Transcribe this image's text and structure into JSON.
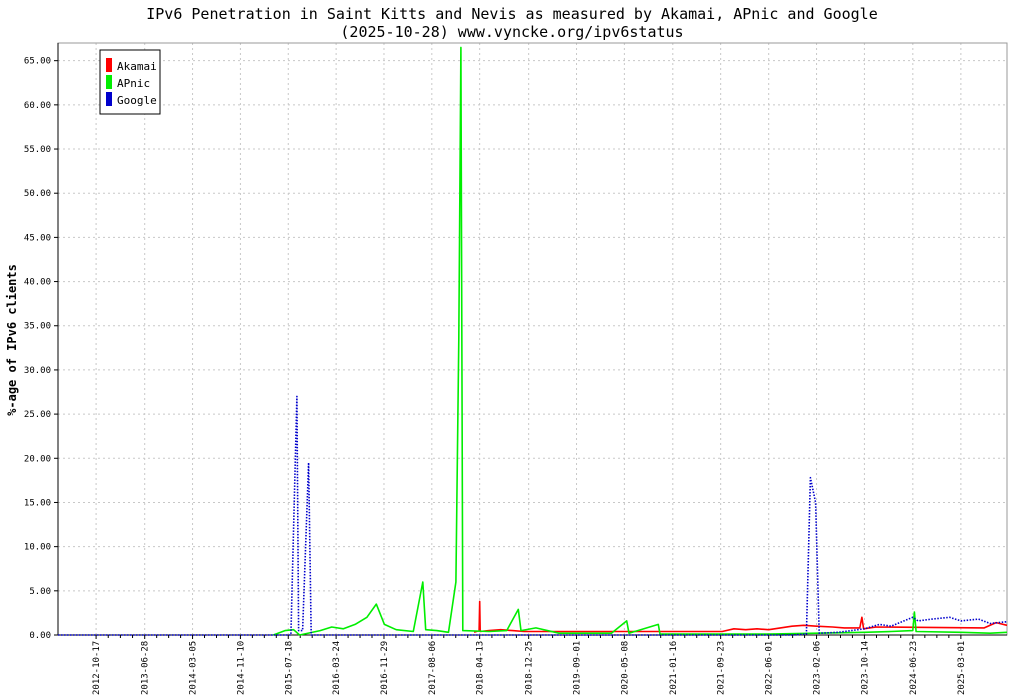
{
  "chart_data": {
    "type": "line",
    "title": "IPv6 Penetration in Saint Kitts and Nevis as measured by Akamai, APnic and Google",
    "subtitle": "(2025-10-28) www.vyncke.org/ipv6status",
    "xlabel": "",
    "ylabel": "%-age of IPv6 clients",
    "x_range": [
      "2012-04-01",
      "2025-10-28"
    ],
    "ylim": [
      0,
      67
    ],
    "y_ticks": [
      "0.00",
      "5.00",
      "10.00",
      "15.00",
      "20.00",
      "25.00",
      "30.00",
      "35.00",
      "40.00",
      "45.00",
      "50.00",
      "55.00",
      "60.00",
      "65.00"
    ],
    "x_ticks": [
      "2012-10-17",
      "2013-06-28",
      "2014-03-05",
      "2014-11-10",
      "2015-07-18",
      "2016-03-24",
      "2016-11-29",
      "2017-08-06",
      "2018-04-13",
      "2018-12-25",
      "2019-09-01",
      "2020-05-08",
      "2021-01-16",
      "2021-09-23",
      "2022-06-01",
      "2023-02-06",
      "2023-10-14",
      "2024-06-23",
      "2025-03-01"
    ],
    "grid": true,
    "legend": "top-left",
    "series": [
      {
        "name": "Akamai",
        "color": "#ff0000",
        "style": "solid",
        "points": [
          [
            "2018-03-15",
            0.3
          ],
          [
            "2018-04-10",
            0.5
          ],
          [
            "2018-04-13",
            3.8
          ],
          [
            "2018-04-16",
            0.4
          ],
          [
            "2018-06-01",
            0.5
          ],
          [
            "2018-08-01",
            0.6
          ],
          [
            "2018-10-01",
            0.5
          ],
          [
            "2018-12-01",
            0.4
          ],
          [
            "2021-10-01",
            0.4
          ],
          [
            "2021-12-01",
            0.7
          ],
          [
            "2022-02-01",
            0.6
          ],
          [
            "2022-04-01",
            0.7
          ],
          [
            "2022-06-01",
            0.6
          ],
          [
            "2022-08-01",
            0.8
          ],
          [
            "2022-10-01",
            1.0
          ],
          [
            "2022-12-01",
            1.1
          ],
          [
            "2023-02-06",
            1.0
          ],
          [
            "2023-05-01",
            0.9
          ],
          [
            "2023-07-01",
            0.8
          ],
          [
            "2023-09-20",
            0.8
          ],
          [
            "2023-10-01",
            2.0
          ],
          [
            "2023-10-10",
            0.7
          ],
          [
            "2023-12-15",
            0.9
          ],
          [
            "2025-07-01",
            0.8
          ],
          [
            "2025-09-01",
            1.4
          ],
          [
            "2025-10-28",
            1.1
          ]
        ]
      },
      {
        "name": "APnic",
        "color": "#00ee00",
        "style": "solid",
        "points": [
          [
            "2015-05-01",
            0.0
          ],
          [
            "2015-07-01",
            0.5
          ],
          [
            "2015-08-15",
            0.6
          ],
          [
            "2015-09-15",
            0.0
          ],
          [
            "2016-01-01",
            0.5
          ],
          [
            "2016-03-01",
            0.9
          ],
          [
            "2016-05-01",
            0.7
          ],
          [
            "2016-07-01",
            1.2
          ],
          [
            "2016-09-01",
            2.0
          ],
          [
            "2016-10-20",
            3.5
          ],
          [
            "2016-12-01",
            1.2
          ],
          [
            "2017-02-01",
            0.6
          ],
          [
            "2017-05-01",
            0.4
          ],
          [
            "2017-06-20",
            6.0
          ],
          [
            "2017-07-05",
            0.6
          ],
          [
            "2017-09-01",
            0.5
          ],
          [
            "2017-11-01",
            0.3
          ],
          [
            "2017-12-10",
            6.0
          ],
          [
            "2017-12-25",
            33.5
          ],
          [
            "2018-01-05",
            66.5
          ],
          [
            "2018-01-15",
            0.5
          ],
          [
            "2018-06-01",
            0.4
          ],
          [
            "2018-09-01",
            0.5
          ],
          [
            "2018-11-01",
            2.9
          ],
          [
            "2018-11-15",
            0.5
          ],
          [
            "2019-02-01",
            0.8
          ],
          [
            "2019-06-01",
            0.2
          ],
          [
            "2020-03-01",
            0.2
          ],
          [
            "2020-05-20",
            1.6
          ],
          [
            "2020-06-01",
            0.2
          ],
          [
            "2020-11-01",
            1.2
          ],
          [
            "2020-11-10",
            0.1
          ],
          [
            "2022-06-01",
            0.1
          ],
          [
            "2023-02-06",
            0.2
          ],
          [
            "2023-10-14",
            0.3
          ],
          [
            "2024-03-01",
            0.4
          ],
          [
            "2024-06-23",
            0.5
          ],
          [
            "2024-07-01",
            2.6
          ],
          [
            "2024-07-10",
            0.4
          ],
          [
            "2025-03-01",
            0.3
          ],
          [
            "2025-08-01",
            0.2
          ],
          [
            "2025-10-28",
            0.3
          ]
        ]
      },
      {
        "name": "Google",
        "color": "#0000cc",
        "style": "dotted",
        "points": [
          [
            "2012-04-01",
            0.0
          ],
          [
            "2015-08-01",
            0.0
          ],
          [
            "2015-09-01",
            27.0
          ],
          [
            "2015-09-10",
            0.5
          ],
          [
            "2015-10-01",
            0.5
          ],
          [
            "2015-11-01",
            19.5
          ],
          [
            "2015-11-15",
            0.0
          ],
          [
            "2022-10-01",
            0.0
          ],
          [
            "2022-12-15",
            0.1
          ],
          [
            "2023-01-05",
            17.8
          ],
          [
            "2023-02-01",
            15.0
          ],
          [
            "2023-02-20",
            0.2
          ],
          [
            "2023-06-01",
            0.3
          ],
          [
            "2023-10-14",
            0.7
          ],
          [
            "2024-01-01",
            1.2
          ],
          [
            "2024-03-01",
            1.0
          ],
          [
            "2024-06-23",
            2.0
          ],
          [
            "2024-07-20",
            1.6
          ],
          [
            "2024-10-01",
            1.8
          ],
          [
            "2025-01-01",
            2.0
          ],
          [
            "2025-03-01",
            1.6
          ],
          [
            "2025-06-01",
            1.8
          ],
          [
            "2025-08-01",
            1.3
          ],
          [
            "2025-10-28",
            1.5
          ]
        ]
      }
    ]
  }
}
